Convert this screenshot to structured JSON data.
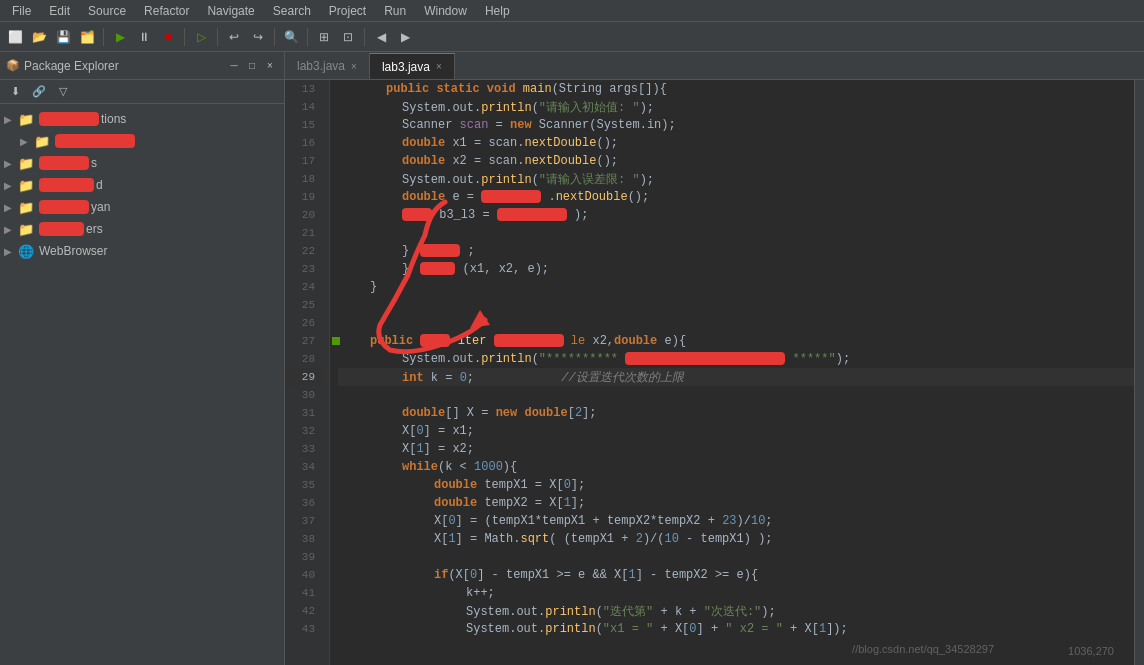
{
  "menu": {
    "items": [
      "File",
      "Edit",
      "Source",
      "Refactor",
      "Navigate",
      "Search",
      "Project",
      "Run",
      "Window",
      "Help"
    ]
  },
  "package_explorer": {
    "title": "Package Explorer",
    "close_label": "×",
    "tree_items": [
      {
        "label": "tions",
        "indent": 0,
        "icon": "📁",
        "arrow": "▶"
      },
      {
        "label": "",
        "indent": 1,
        "icon": "📁",
        "arrow": "▶",
        "redacted": true
      },
      {
        "label": "s",
        "indent": 0,
        "icon": "📁",
        "arrow": "▶"
      },
      {
        "label": "d",
        "indent": 0,
        "icon": "📁",
        "arrow": "▶"
      },
      {
        "label": "yan",
        "indent": 0,
        "icon": "📁",
        "arrow": "▶"
      },
      {
        "label": "ers",
        "indent": 0,
        "icon": "📁",
        "arrow": "▶"
      },
      {
        "label": "WebBrowser",
        "indent": 0,
        "icon": "🌐",
        "arrow": "▶"
      }
    ]
  },
  "editor": {
    "tabs": [
      {
        "label": "lab3.java",
        "active": false
      },
      {
        "label": "lab3.java",
        "active": true
      }
    ],
    "lines": [
      {
        "num": 13,
        "content_raw": "public static void main(String args[]){",
        "indent": 6
      },
      {
        "num": 14,
        "content_raw": "System.out.println(\"请输入初始值: \");",
        "indent": 8
      },
      {
        "num": 15,
        "content_raw": "Scanner scan = new Scanner(System.in);",
        "indent": 8
      },
      {
        "num": 16,
        "content_raw": "double x1 = scan.nextDouble();",
        "indent": 8
      },
      {
        "num": 17,
        "content_raw": "double x2 = scan.nextDouble();",
        "indent": 8
      },
      {
        "num": 18,
        "content_raw": "System.out.println(\"请输入误差限: \");",
        "indent": 8
      },
      {
        "num": 19,
        "content_raw": "double e = ...nextDouble();",
        "indent": 8
      },
      {
        "num": 20,
        "content_raw": "...b3_l3 = ...());",
        "indent": 8
      },
      {
        "num": 21,
        "content_raw": "",
        "indent": 0
      },
      {
        "num": 22,
        "content_raw": "} ...",
        "indent": 8
      },
      {
        "num": 23,
        "content_raw": "} ...(x1, x2, e);",
        "indent": 8
      },
      {
        "num": 24,
        "content_raw": "}",
        "indent": 4
      },
      {
        "num": 25,
        "content_raw": "",
        "indent": 0
      },
      {
        "num": 26,
        "content_raw": "",
        "indent": 0
      },
      {
        "num": 27,
        "content_raw": "public void ...(double ...le x2,double e){",
        "indent": 4,
        "dot": true
      },
      {
        "num": 28,
        "content_raw": "System.out.println(\"**********...****\");",
        "indent": 8
      },
      {
        "num": 29,
        "content_raw": "int k = 0;",
        "indent": 8,
        "comment": "//设置迭代次数的上限"
      },
      {
        "num": 30,
        "content_raw": "",
        "indent": 0
      },
      {
        "num": 31,
        "content_raw": "double[] X = new double[2];",
        "indent": 8
      },
      {
        "num": 32,
        "content_raw": "X[0] = x1;",
        "indent": 8
      },
      {
        "num": 33,
        "content_raw": "X[1] = x2;",
        "indent": 8
      },
      {
        "num": 34,
        "content_raw": "while(k < 1000){",
        "indent": 8
      },
      {
        "num": 35,
        "content_raw": "double tempX1 = X[0];",
        "indent": 12
      },
      {
        "num": 36,
        "content_raw": "double tempX2 = X[1];",
        "indent": 12
      },
      {
        "num": 37,
        "content_raw": "X[0] = (tempX1*tempX1 + tempX2*tempX2 + 23)/10;",
        "indent": 12
      },
      {
        "num": 38,
        "content_raw": "X[1] = Math.sqrt( (tempX1 + 2)/(10 - tempX1) );",
        "indent": 12
      },
      {
        "num": 39,
        "content_raw": "",
        "indent": 0
      },
      {
        "num": 40,
        "content_raw": "if(X[0] - tempX1 >= e && X[1] - tempX2 >= e){",
        "indent": 12
      },
      {
        "num": 41,
        "content_raw": "k++;",
        "indent": 16
      },
      {
        "num": 42,
        "content_raw": "System.out.println(\"迭代第\" + k + \"次迭代:\");",
        "indent": 16
      },
      {
        "num": 43,
        "content_raw": "System.out.println(\"x1 = \" + X[0] + \"   x2 = \" + X[1]);",
        "indent": 16
      }
    ]
  },
  "cursor": {
    "line": 29,
    "char_pos": "1036,270"
  },
  "watermark": "//blog.csdn.net/qq_34528297"
}
